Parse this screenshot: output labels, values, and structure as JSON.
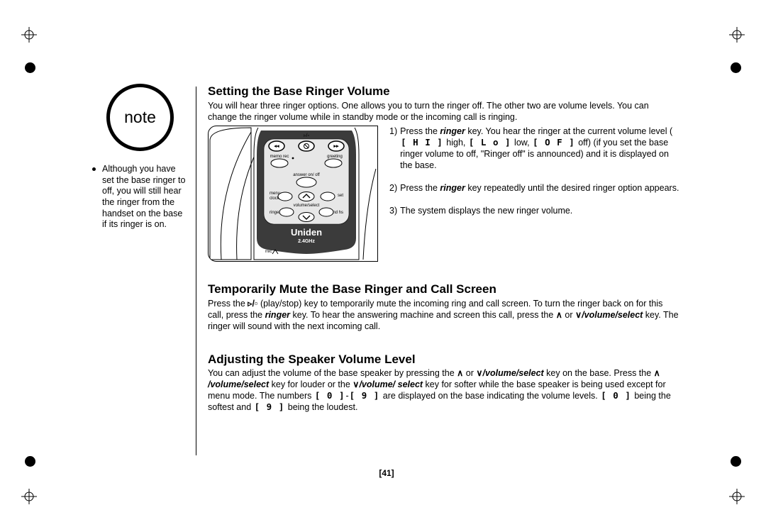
{
  "note": {
    "label": "note",
    "item": "Although you have set the base ringer to off, you will still hear the ringer from the handset on the base if its ringer is on."
  },
  "section1": {
    "heading": "Setting the Base Ringer Volume",
    "intro": "You will hear three ringer options. One allows you to turn the ringer off. The other two are volume levels. You can change the ringer volume while in standby mode or the incoming call is ringing.",
    "step1a": "Press the ",
    "step1_key": "ringer",
    "step1b": " key. You hear the ringer at the current volume level (",
    "hi": "[ H I ]",
    "step1c": " high, ",
    "lo": "[ L o ]",
    "step1d": " low, ",
    "off": "[ O F ]",
    "step1e": " off) (if you set the base ringer volume to off, \"Ringer off\" is announced) and it is displayed on the base.",
    "step2a": "Press the ",
    "step2_key": "ringer",
    "step2b": " key repeatedly until the desired ringer option appears.",
    "step3": "The system displays the new ringer volume."
  },
  "section2": {
    "heading": "Temporarily Mute the Base Ringer and Call Screen",
    "p1": "Press the ",
    "ps": "▹/▫",
    "p2": " (play/stop) key to temporarily mute the incoming ring and call screen. To turn the ringer back on for this call, press the ",
    "ringer_key": "ringer",
    "p3": " key. To hear the answering machine and screen this call, press the ",
    "up": "∧",
    "or": " or ",
    "down": "∨",
    "vs": "/volume/select",
    "p4": " key. The ringer will sound with the next incoming call."
  },
  "section3": {
    "heading": "Adjusting the Speaker Volume Level",
    "p1": "You can adjust the volume of the base speaker by pressing the ",
    "up": "∧",
    "or": " or ",
    "down": "∨",
    "vs": "/volume/select",
    "p2": " key on the base. Press the ",
    "up2": "∧",
    "vs2": "/volume/select",
    "p3": " key for louder or the ",
    "down2": "∨",
    "vs3": "/volume/ select",
    "p4": " key for softer while the base speaker is being used except for menu mode. The numbers ",
    "n0": "[ 0 ]",
    "dash": "-",
    "n9": "[ 9 ]",
    "p5": " are displayed on the base indicating the volume levels. ",
    "n0b": "[ 0 ]",
    "p6": " being the softest and ",
    "n9b": "[ 9 ]",
    "p7": " being the loudest."
  },
  "page_number": "[41]",
  "illus": {
    "memo_rec": "memo  rec",
    "greeting": "greeting",
    "answer": "answer on/ off",
    "menu": "menu",
    "clock": "clock",
    "set": "set",
    "volsel": "volume/select",
    "ringer": "ringer",
    "findhs": "find hs",
    "brand": "Uniden",
    "freq": "2.4GHz",
    "mic": "mic",
    "playstop": "▹/▫"
  }
}
